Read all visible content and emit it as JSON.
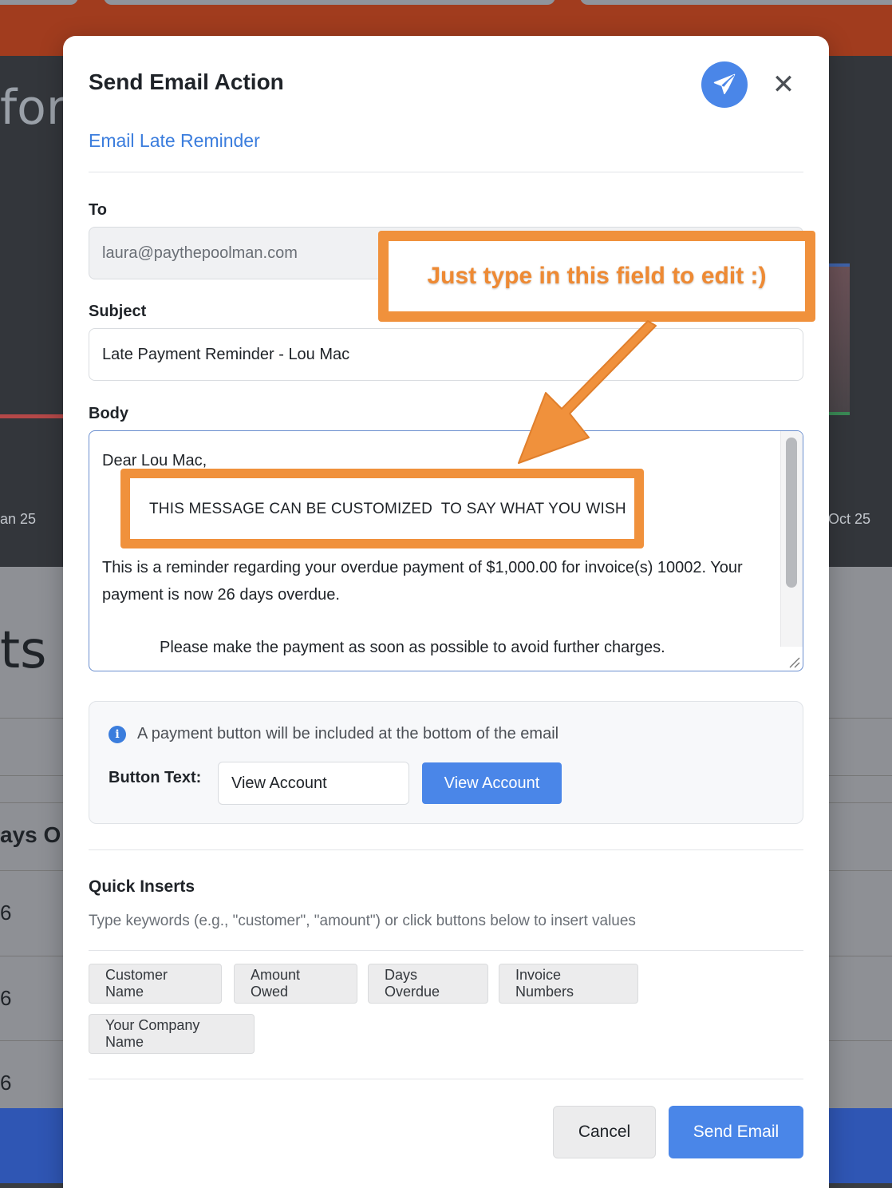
{
  "background": {
    "title_fragment": "forr",
    "tick_left": "an 25",
    "tick_right": "Oct 25",
    "section_fragment": "ts",
    "column_fragment": "ays O",
    "row_values": [
      "6",
      "6",
      "6"
    ]
  },
  "modal": {
    "title": "Send Email Action",
    "subtitle": "Email Late Reminder",
    "send_icon": "paper-plane-icon",
    "close_icon": "close-icon",
    "close_glyph": "✕"
  },
  "form": {
    "to_label": "To",
    "to_value": "laura@paythepoolman.com",
    "subject_label": "Subject",
    "subject_value": "Late Payment Reminder - Lou Mac",
    "body_label": "Body",
    "body": {
      "greeting": "Dear Lou Mac,",
      "custom_line": "THIS MESSAGE CAN BE CUSTOMIZED  TO SAY WHAT YOU WISH",
      "paragraph": "This is a reminder regarding your overdue payment of $1,000.00 for invoice(s) 10002. Your payment is now 26 days overdue.",
      "closing": "Please make the payment as soon as possible to avoid further charges."
    }
  },
  "payment_button": {
    "info_icon": "info-icon",
    "info_glyph": "i",
    "info_text": "A payment button will be included at the bottom of the email",
    "label": "Button Text:",
    "input_value": "View Account",
    "preview_label": "View Account"
  },
  "quick_inserts": {
    "title": "Quick Inserts",
    "description": "Type keywords (e.g., \"customer\", \"amount\") or click buttons below to insert values",
    "chips": [
      "Customer Name",
      "Amount Owed",
      "Days Overdue",
      "Invoice Numbers",
      "Your Company Name"
    ]
  },
  "footer": {
    "cancel_label": "Cancel",
    "send_label": "Send Email"
  },
  "annotation": {
    "callout_text": "Just type in this field to edit :)",
    "color": "#f0913c"
  },
  "colors": {
    "accent": "#4a86e8",
    "link": "#3b7ddd",
    "header_bg": "#a13c1e"
  }
}
